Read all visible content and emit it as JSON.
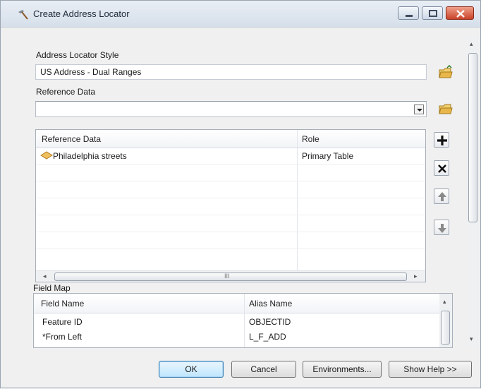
{
  "window": {
    "title": "Create Address Locator"
  },
  "form": {
    "style_label": "Address Locator Style",
    "style_value": "US Address - Dual Ranges",
    "reference_data_label": "Reference Data",
    "reference_data_value": ""
  },
  "reference_table": {
    "columns": [
      "Reference Data",
      "Role"
    ],
    "rows": [
      {
        "reference_data": "Philadelphia streets",
        "role": "Primary Table"
      }
    ],
    "scroll_glyph": "III"
  },
  "field_map": {
    "label": "Field Map",
    "columns": [
      "Field Name",
      "Alias Name"
    ],
    "rows": [
      {
        "field": "Feature ID",
        "alias": "OBJECTID"
      },
      {
        "field": "*From Left",
        "alias": "L_F_ADD"
      }
    ]
  },
  "buttons": {
    "ok": "OK",
    "cancel": "Cancel",
    "environments": "Environments...",
    "show_help": "Show Help >>"
  },
  "icons": {
    "title": "hammer-icon",
    "folder": "open-folder-icon",
    "add": "plus-icon",
    "remove": "x-icon",
    "up": "up-arrow-icon",
    "down": "down-arrow-icon",
    "layer": "line-feature-layer-icon"
  },
  "colors": {
    "accent": "#3c7fb1",
    "close_button": "#c9432a",
    "folder": "#e8b64a"
  }
}
